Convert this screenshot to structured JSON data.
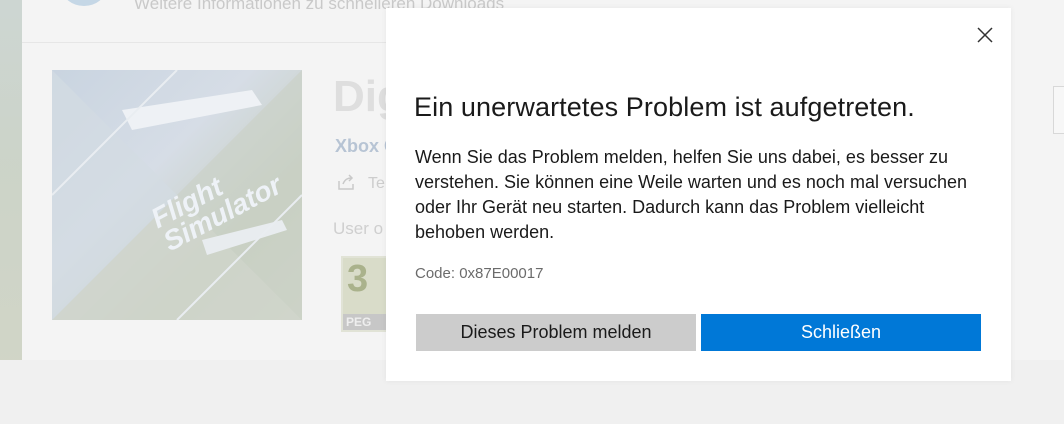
{
  "background": {
    "hint_text": "Weitere Informationen zu schnelleren Downloads",
    "cover": {
      "title_line1": "Flight",
      "title_line2": "Simulator"
    },
    "product_title": "Dig",
    "publisher": "Xbox G",
    "share_label": "Te",
    "user_text": "User o",
    "rating": {
      "number": "3",
      "label": "PEG"
    }
  },
  "dialog": {
    "title": "Ein unerwartetes Problem ist aufgetreten.",
    "message": "Wenn Sie das Problem melden, helfen Sie uns dabei, es besser zu verstehen. Sie können eine Weile warten und es noch mal versuchen oder Ihr Gerät neu starten. Dadurch kann das Problem vielleicht behoben werden.",
    "code": "Code: 0x87E00017",
    "report_button": "Dieses Problem melden",
    "close_button": "Schließen",
    "close_icon": "close-icon"
  },
  "colors": {
    "accent": "#0078d7",
    "secondary_button": "#cccccc",
    "dialog_bg": "#ffffff",
    "text": "#1a1a1a",
    "muted_text": "#6b6b6b"
  }
}
